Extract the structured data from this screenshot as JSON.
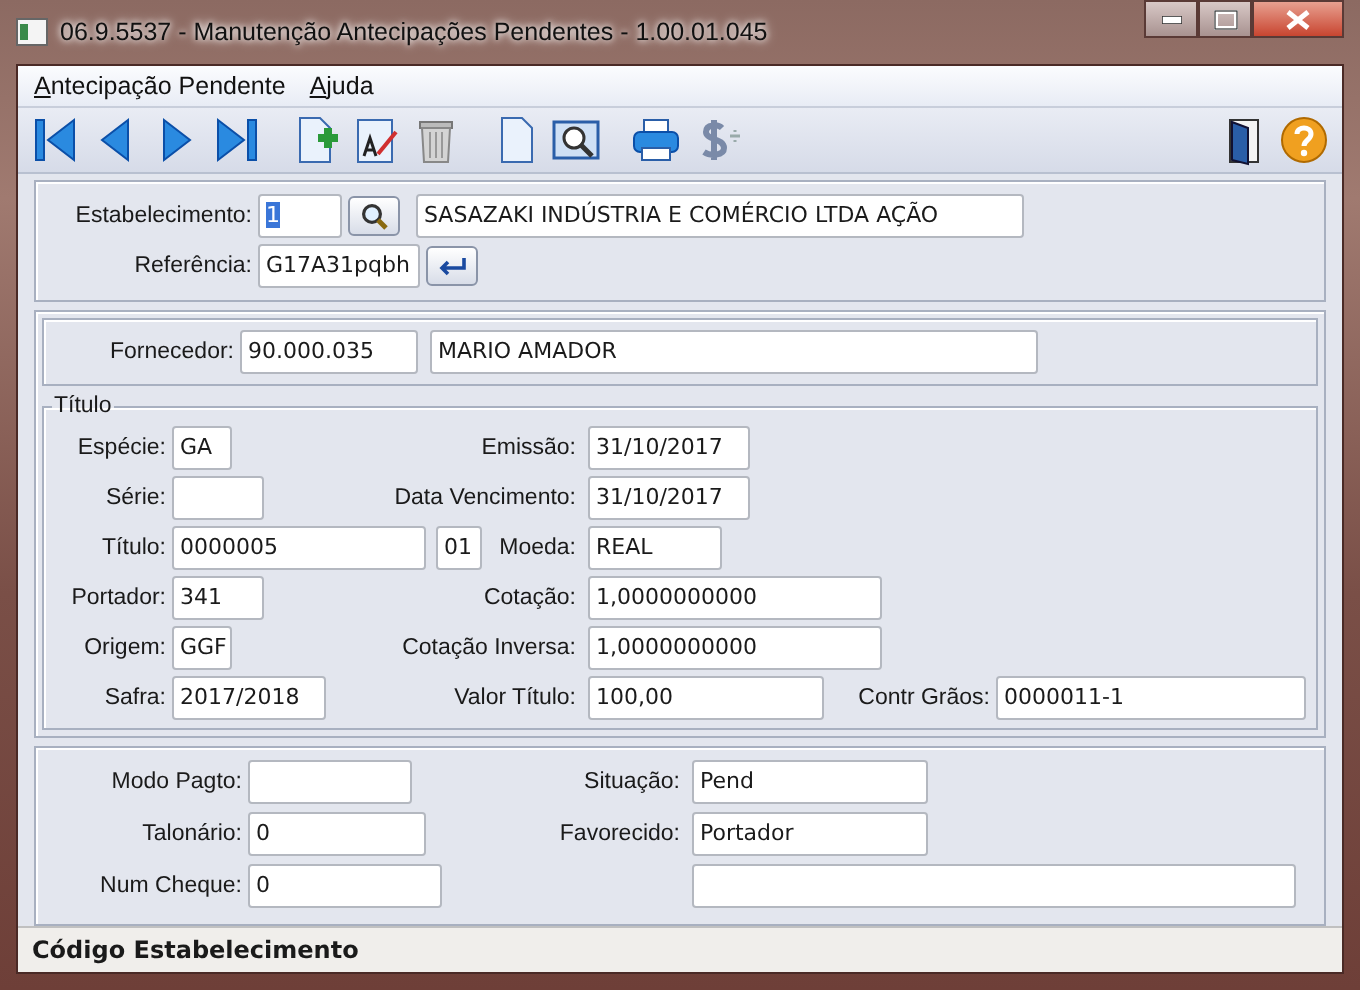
{
  "window": {
    "title": "06.9.5537 - Manutenção Antecipações Pendentes - 1.00.01.045"
  },
  "menu": [
    {
      "label": "Antecipação Pendente"
    },
    {
      "label": "Ajuda"
    }
  ],
  "header": {
    "estabelecimento": {
      "label": "Estabelecimento:",
      "value": "1",
      "selected": true,
      "name": "SASAZAKI INDÚSTRIA E COMÉRCIO LTDA AÇÃO"
    },
    "referencia": {
      "label": "Referência:",
      "value": "G17A31pqbh"
    }
  },
  "fornecedor": {
    "label": "Fornecedor:",
    "value": "90.000.035",
    "name": "MARIO AMADOR"
  },
  "titulo": {
    "legend": "Título",
    "rows": [
      [
        {
          "label": "Espécie:",
          "value": "GA"
        },
        {
          "label": "Emissão:",
          "value": "31/10/2017"
        }
      ],
      [
        {
          "label": "Série:"
        },
        {
          "label": "Data Vencimento:",
          "value": "31/10/2017"
        }
      ],
      [
        {
          "label": "Título:",
          "value": "0000005",
          "value_2": "01"
        },
        {
          "label": "Moeda:",
          "value": "REAL"
        }
      ],
      [
        {
          "label": "Portador:",
          "value": "341"
        },
        {
          "label": "Cotação:",
          "value": "1,0000000000"
        }
      ],
      [
        {
          "label": "Origem:",
          "value": "GGF"
        },
        {
          "label": "Cotação Inversa:",
          "value": "1,0000000000"
        }
      ],
      [
        {
          "label": "Safra:",
          "value": "2017/2018"
        },
        {
          "label": "Valor Título:",
          "value": "100,00"
        },
        {
          "label": "Contr Grãos:",
          "value": "0000011-1"
        }
      ]
    ]
  },
  "pagamento": {
    "rows": [
      [
        {
          "label": "Modo Pagto:"
        },
        {
          "label": "Situação:",
          "value": "Pend"
        }
      ],
      [
        {
          "label": "Talonário:",
          "value": "0"
        },
        {
          "label": "Favorecido:",
          "value": "Portador"
        }
      ],
      [
        {
          "label": "Num Cheque:",
          "value": "0"
        },
        {}
      ]
    ]
  },
  "status_bar": "Código Estabelecimento"
}
